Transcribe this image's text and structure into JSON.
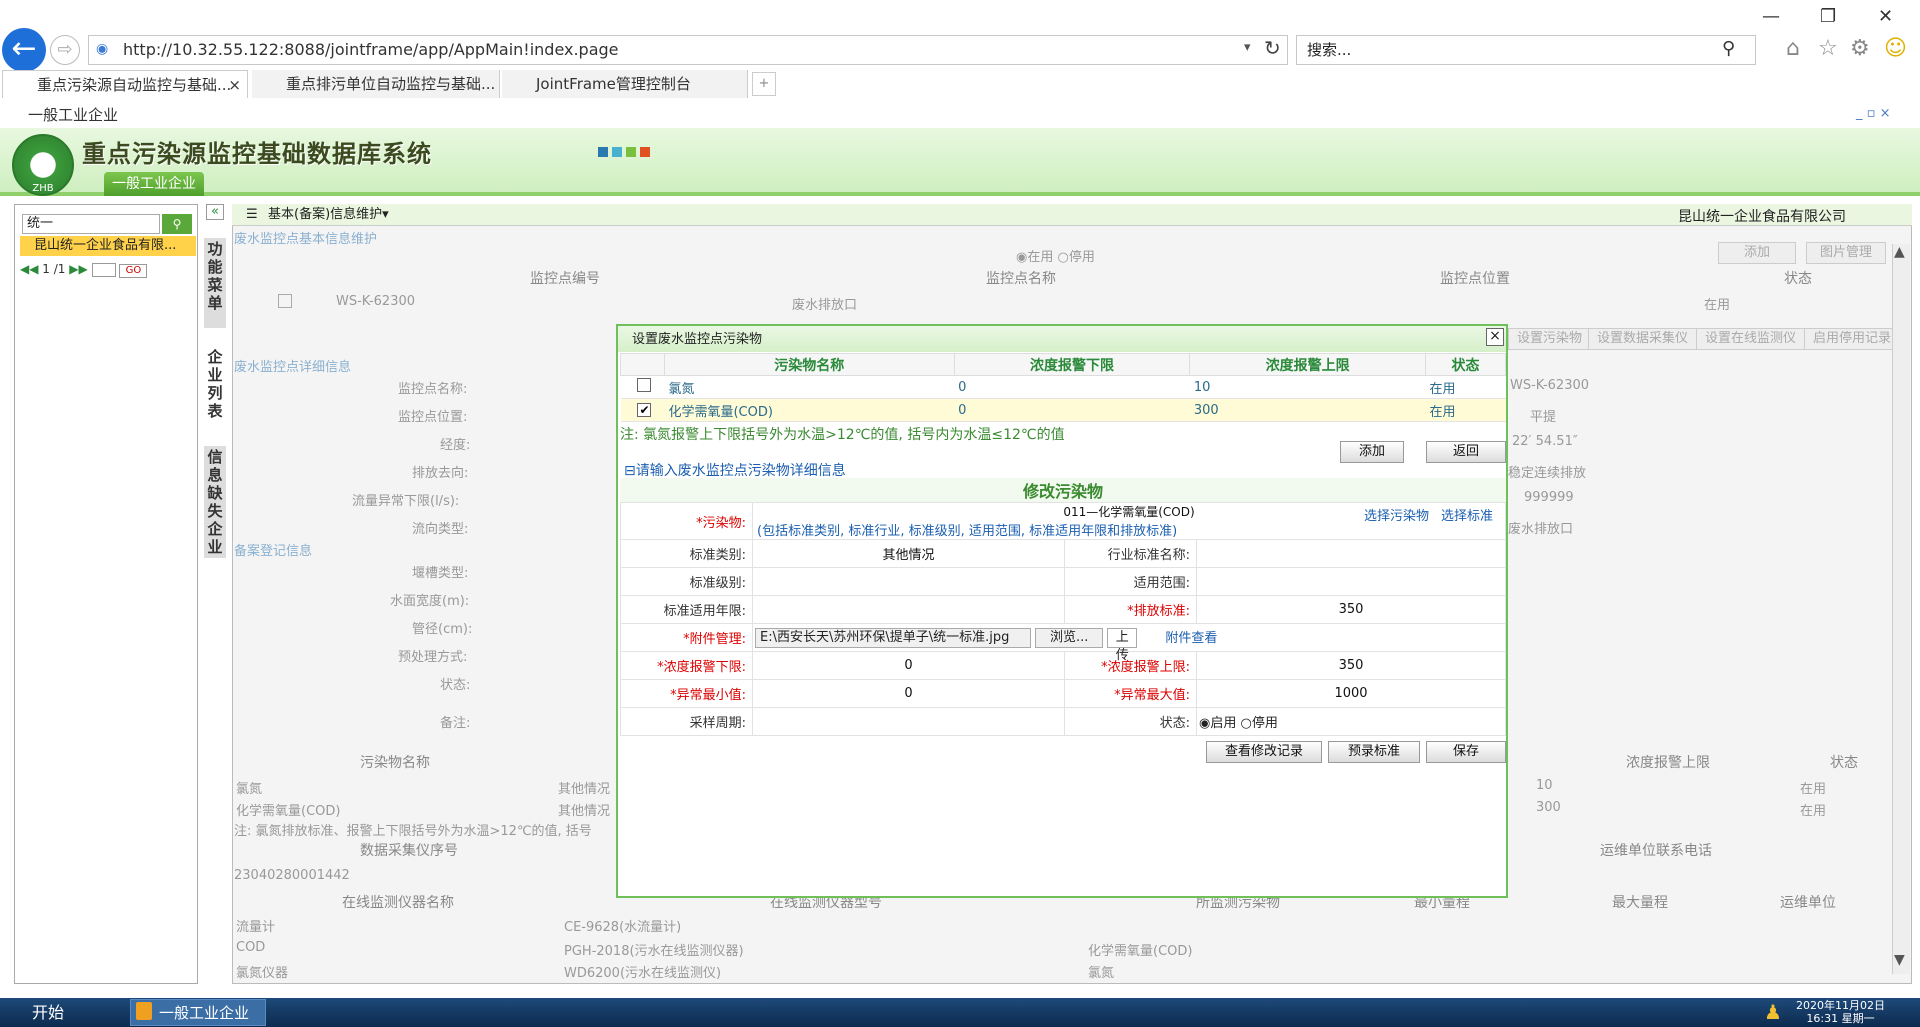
{
  "browser": {
    "url": "http://10.32.55.122:8088/jointframe/app/AppMain!index.page",
    "search_placeholder": "搜索...",
    "tabs": [
      {
        "label": "重点污染源自动监控与基础..."
      },
      {
        "label": "重点排污单位自动监控与基础..."
      },
      {
        "label": "JointFrame管理控制台"
      }
    ]
  },
  "app": {
    "window_title": "一般工业企业",
    "system_title": "重点污染源监控基础数据库系统",
    "logo_text": "ZHB",
    "nav_tab": "一般工业企业"
  },
  "left": {
    "search_value": "统一",
    "search_btn": "GO",
    "company": "昆山统一企业食品有限...",
    "page": "1   /1",
    "vtabs": [
      "功能菜单",
      "企业列表",
      "信息缺失企业"
    ]
  },
  "main": {
    "menu": "基本(备案)信息维护▾",
    "company": "昆山统一企业食品有限公司",
    "section1": "废水监控点基本信息维护",
    "radio_use": "在用",
    "radio_stop": "停用",
    "btn_add": "添加",
    "btn_img": "图片管理",
    "cols": [
      "监控点编号",
      "监控点名称",
      "监控点位置",
      "状态"
    ],
    "row": [
      "WS-K-62300",
      "废水排放口",
      "在用"
    ],
    "right_btns": [
      "设置污染物",
      "设置数据采集仪",
      "设置在线监测仪",
      "启用停用记录"
    ],
    "section2": "废水监控点详细信息",
    "detail_labels": [
      "监控点名称:",
      "监控点位置:",
      "经度:",
      "排放去向:",
      "流量异常下限(l/s):",
      "流向类型:"
    ],
    "detail_right": [
      "WS-K-62300",
      "平提",
      "22′ 54.51″",
      "稳定连续排放",
      "999999",
      "废水排放口"
    ],
    "section3": "备案登记信息",
    "reg_labels": [
      "堰槽类型:",
      "水面宽度(m):",
      "管径(cm):",
      "预处理方式:",
      "状态:",
      "备注:"
    ],
    "p_cols": [
      "污染物名称",
      "浓度报警上限",
      "状态"
    ],
    "p_rows": [
      [
        "氯氮",
        "其他情况",
        "10",
        "在用"
      ],
      [
        "化学需氧量(COD)",
        "其他情况",
        "300",
        "在用"
      ]
    ],
    "p_note": "注: 氯氮排放标准、报警上下限括号外为水温>12℃的值, 括号",
    "dc_head": "数据采集仪序号",
    "dc_val": "23040280001442",
    "ops_head": "运维单位联系电话",
    "inst_cols": [
      "在线监测仪器名称",
      "在线监测仪器型号",
      "所监测污染物",
      "最小量程",
      "最大量程",
      "运维单位"
    ],
    "inst_rows": [
      [
        "流量计",
        "CE-9628(水流量计)",
        ""
      ],
      [
        "COD",
        "PGH-2018(污水在线监测仪器)",
        "化学需氧量(COD)"
      ],
      [
        "氯氮仪器",
        "WD6200(污水在线监测仪)",
        "氯氮"
      ]
    ]
  },
  "dialog": {
    "title": "设置废水监控点污染物",
    "cols": [
      "污染物名称",
      "浓度报警下限",
      "浓度报警上限",
      "状态"
    ],
    "rows": [
      {
        "checked": false,
        "name": "氯氮",
        "low": "0",
        "high": "10",
        "status": "在用"
      },
      {
        "checked": true,
        "name": "化学需氧量(COD)",
        "low": "0",
        "high": "300",
        "status": "在用"
      }
    ],
    "note": "注: 氯氮报警上下限括号外为水温>12℃的值, 括号内为水温≤12℃的值",
    "btn_add": "添加",
    "btn_back": "返回",
    "sub_title": "请输入废水监控点污染物详细信息",
    "mod_title": "修改污染物",
    "form": {
      "pollutant_label": "*污染物:",
      "pollutant_value": "011—化学需氧量(COD)",
      "pollutant_hint": "(包括标准类别, 标准行业, 标准级别, 适用范围, 标准适用年限和排放标准)",
      "link_select_pollutant": "选择污染物",
      "link_select_std": "选择标准",
      "std_type_label": "标准类别:",
      "std_type_value": "其他情况",
      "industry_label": "行业标准名称:",
      "industry_value": "",
      "std_level_label": "标准级别:",
      "scope_label": "适用范围:",
      "years_label": "标准适用年限:",
      "discharge_label": "*排放标准:",
      "discharge_value": "350",
      "attach_label": "*附件管理:",
      "attach_path": "E:\\西安长天\\苏州环保\\提单子\\统一标准.jpg",
      "browse_btn": "浏览...",
      "upload_btn": "上传",
      "attach_view": "附件查看",
      "low_label": "*浓度报警下限:",
      "low_value": "0",
      "high_label": "*浓度报警上限:",
      "high_value": "350",
      "min_label": "*异常最小值:",
      "min_value": "0",
      "max_label": "*异常最大值:",
      "max_value": "1000",
      "cycle_label": "采样周期:",
      "status_label": "状态:",
      "status_on": "启用",
      "status_off": "停用"
    },
    "btn_history": "查看修改记录",
    "btn_preset": "预录标准",
    "btn_save": "保存"
  },
  "taskbar": {
    "start": "开始",
    "task": "一般工业企业",
    "date": "2020年11月02日",
    "time": "16:31 星期一"
  }
}
